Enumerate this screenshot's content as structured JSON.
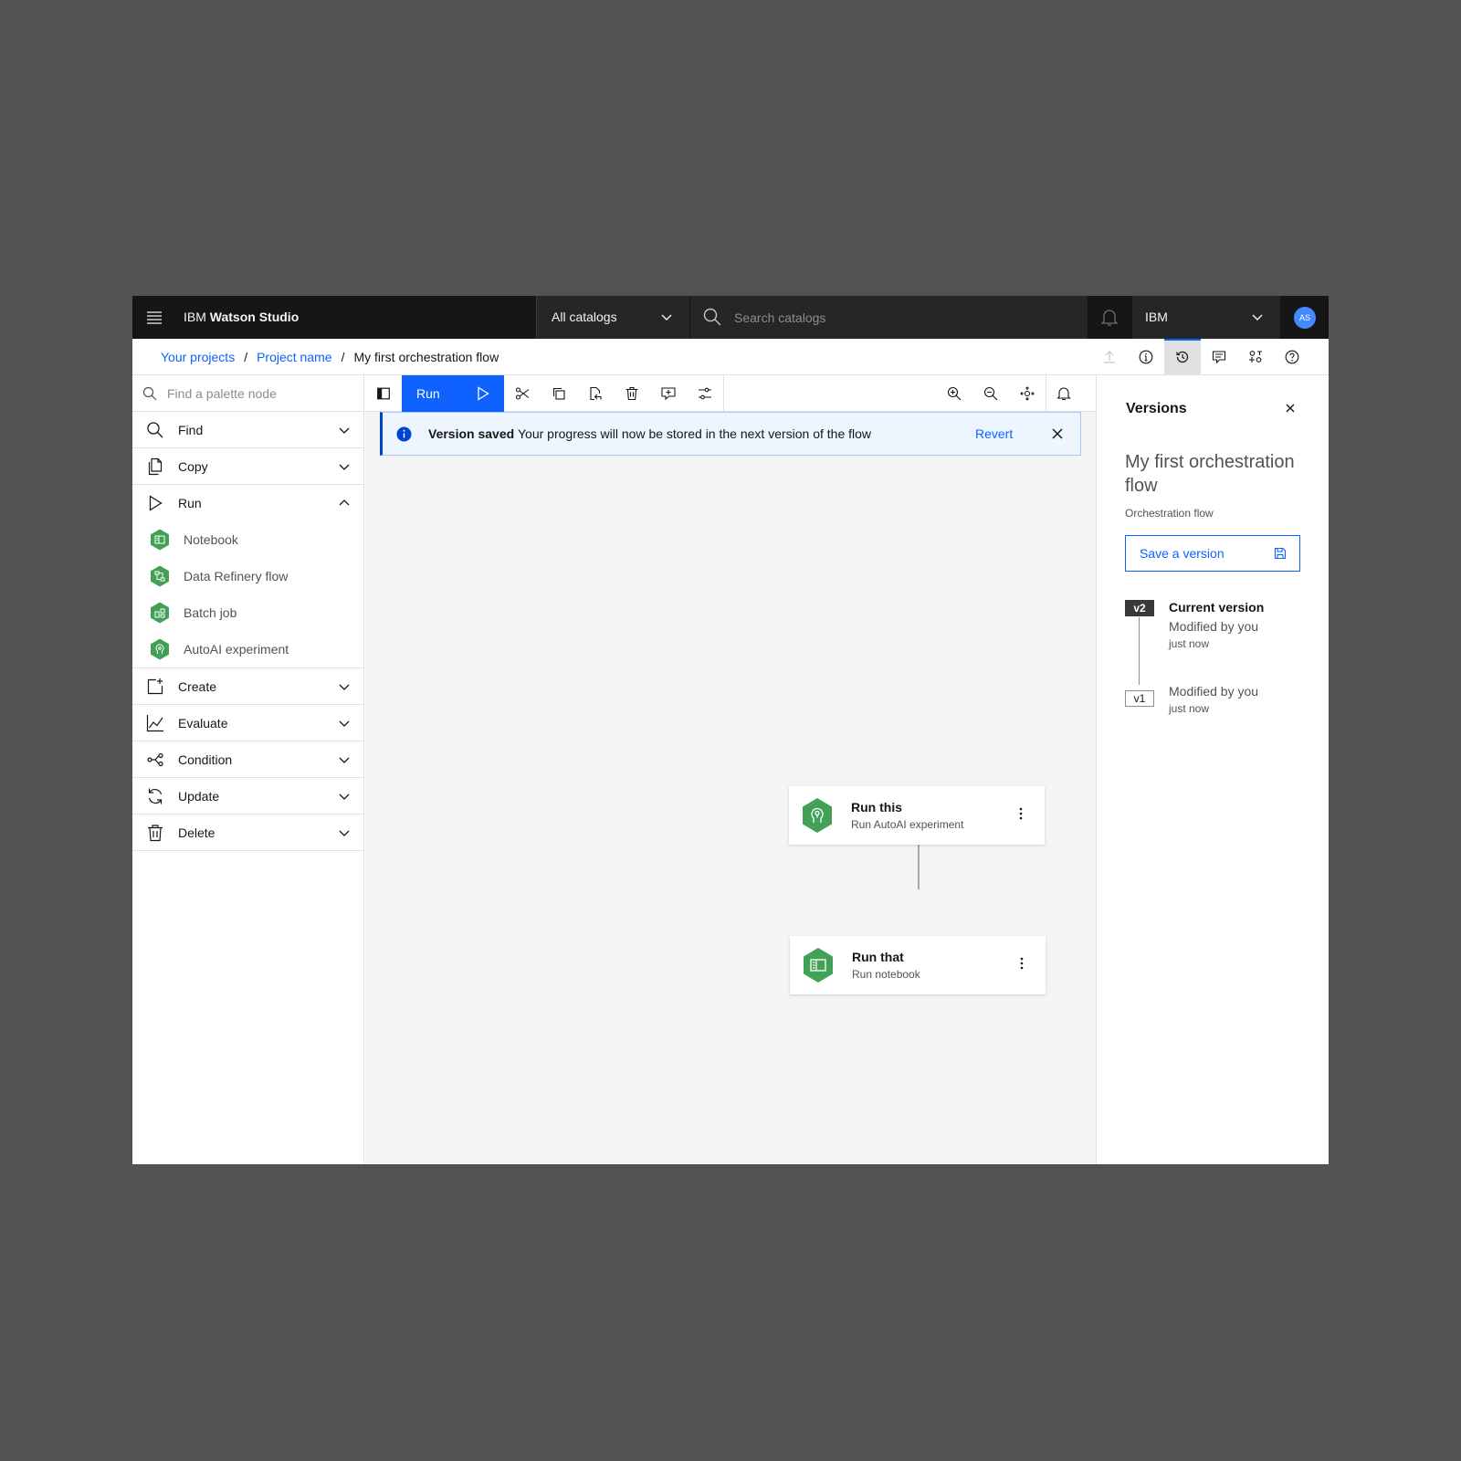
{
  "header": {
    "brand_prefix": "IBM",
    "brand_name": "Watson Studio",
    "catalog_select": "All catalogs",
    "search_placeholder": "Search catalogs",
    "account": "IBM",
    "avatar_initials": "AS"
  },
  "breadcrumb": {
    "items": [
      "Your projects",
      "Project name"
    ],
    "current": "My first orchestration flow",
    "separator": "/"
  },
  "palette": {
    "search_placeholder": "Find a palette node",
    "categories": [
      {
        "label": "Find",
        "icon": "search-icon"
      },
      {
        "label": "Copy",
        "icon": "copy-icon"
      },
      {
        "label": "Run",
        "icon": "play-icon",
        "expanded": true
      },
      {
        "label": "Create",
        "icon": "add-document-icon"
      },
      {
        "label": "Evaluate",
        "icon": "line-chart-icon"
      },
      {
        "label": "Condition",
        "icon": "flow-branch-icon"
      },
      {
        "label": "Update",
        "icon": "renew-icon"
      },
      {
        "label": "Delete",
        "icon": "trash-icon"
      }
    ],
    "run_items": [
      "Notebook",
      "Data Refinery flow",
      "Batch job",
      "AutoAI experiment"
    ]
  },
  "toolbar": {
    "run_label": "Run"
  },
  "notification": {
    "title": "Version saved",
    "message": "Your progress will now be stored in the next version of the flow",
    "action": "Revert",
    "kind": "info"
  },
  "nodes": [
    {
      "title": "Run this",
      "subtitle": "Run AutoAI experiment",
      "icon": "autoai-icon"
    },
    {
      "title": "Run that",
      "subtitle": "Run notebook",
      "icon": "notebook-icon"
    }
  ],
  "versions_panel": {
    "title": "Versions",
    "flow_name": "My first orchestration flow",
    "flow_type": "Orchestration flow",
    "save_button": "Save a version",
    "entries": [
      {
        "tag": "v2",
        "title": "Current version",
        "modified": "Modified by you",
        "when": "just now"
      },
      {
        "tag": "v1",
        "title": "",
        "modified": "Modified by you",
        "when": "just now"
      }
    ]
  },
  "colors": {
    "accent": "#0f62fe",
    "node_green": "#42a156",
    "header_bg": "#161616",
    "canvas_bg": "#f4f4f4"
  }
}
